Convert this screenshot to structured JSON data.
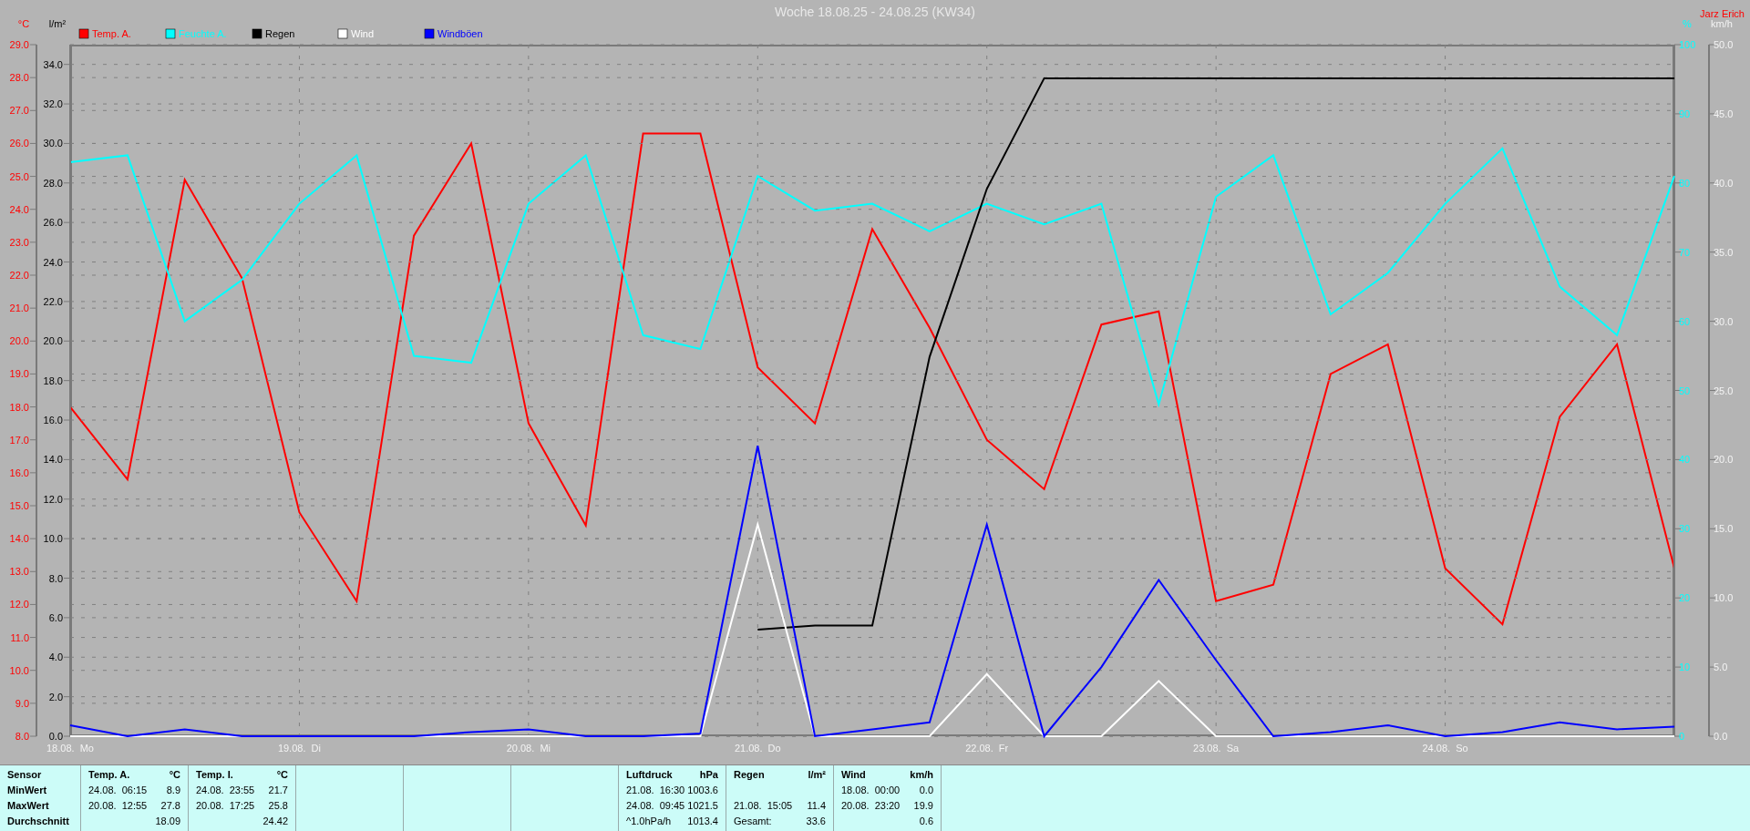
{
  "title": "Woche 18.08.25 - 24.08.25 (KW34)",
  "author": "Jarz Erich",
  "panels": [
    {
      "chart_data": {
        "type": "line",
        "ylabel": "°C",
        "grid": true,
        "legend": "top",
        "categories": [
          "18.08.  Mo",
          null,
          null,
          null,
          "19.08.  Di",
          null,
          null,
          null,
          "20.08.  Mi",
          null,
          null,
          null,
          "21.08.  Do",
          null,
          null,
          null,
          "22.08.  Fr",
          null,
          null,
          null,
          "23.08.  Sa",
          null,
          null,
          null,
          "24.08.  So",
          null,
          null,
          null,
          null
        ],
        "ylim": [
          8,
          29
        ],
        "yticks": [
          {
            "value": 29,
            "label": "29.0"
          },
          {
            "value": 28,
            "label": "28.0"
          },
          {
            "value": 27,
            "label": "27.0"
          },
          {
            "value": 26,
            "label": "26.0"
          },
          {
            "value": 25,
            "label": "25.0"
          },
          {
            "value": 24,
            "label": "24.0"
          },
          {
            "value": 23,
            "label": "23.0"
          },
          {
            "value": 22,
            "label": "22.0"
          },
          {
            "value": 21,
            "label": "21.0"
          },
          {
            "value": 20,
            "label": "20.0"
          },
          {
            "value": 19,
            "label": "19.0"
          },
          {
            "value": 18,
            "label": "18.0"
          },
          {
            "value": 17,
            "label": "17.0"
          },
          {
            "value": 16,
            "label": "16.0"
          },
          {
            "value": 15,
            "label": "15.0"
          },
          {
            "value": 14,
            "label": "14.0"
          },
          {
            "value": 13,
            "label": "13.0"
          },
          {
            "value": 12,
            "label": "12.0"
          },
          {
            "value": 11,
            "label": "11.0"
          },
          {
            "value": 10,
            "label": "10.0"
          },
          {
            "value": 9,
            "label": "9.0"
          },
          {
            "value": 8,
            "label": "8.0"
          }
        ],
        "series": [
          {
            "name": "Temp. A.",
            "color": "#ff0000",
            "values": [
              18.0,
              15.8,
              24.9,
              21.9,
              14.8,
              12.1,
              23.2,
              26.0,
              17.5,
              14.4,
              26.3,
              26.3,
              19.2,
              17.5,
              23.4,
              20.4,
              17.0,
              15.5,
              20.5,
              20.9,
              12.1,
              12.6,
              19.0,
              19.9,
              13.1,
              11.4,
              17.7,
              19.9,
              13.1
            ]
          }
        ]
      }
    },
    {
      "chart_data": {
        "type": "line",
        "ylabel": "%",
        "legend": "top",
        "categories": [
          null,
          null,
          null,
          null,
          null,
          null,
          null,
          null,
          null,
          null,
          null,
          null,
          null,
          null,
          null,
          null,
          null,
          null,
          null,
          null,
          null,
          null,
          null,
          null,
          null,
          null,
          null,
          null,
          null
        ],
        "ylim": [
          0,
          100
        ],
        "yticks": [
          {
            "value": 100,
            "label": "100"
          },
          {
            "value": 90,
            "label": "90"
          },
          {
            "value": 80,
            "label": "80"
          },
          {
            "value": 70,
            "label": "70"
          },
          {
            "value": 60,
            "label": "60"
          },
          {
            "value": 50,
            "label": "50"
          },
          {
            "value": 40,
            "label": "40"
          },
          {
            "value": 30,
            "label": "30"
          },
          {
            "value": 20,
            "label": "20"
          },
          {
            "value": 10,
            "label": "10"
          },
          {
            "value": 0,
            "label": "0"
          }
        ],
        "series": [
          {
            "name": "Feuchte A.",
            "color": "#00ffff",
            "values": [
              83,
              84,
              60,
              66,
              77,
              84,
              55,
              54,
              77,
              84,
              58,
              56,
              81,
              76,
              77,
              73,
              77,
              74,
              77,
              48,
              78,
              84,
              61,
              67,
              77,
              85,
              65,
              58,
              81
            ]
          }
        ]
      }
    },
    {
      "chart_data": {
        "type": "line",
        "ylabel": "l/m²",
        "grid": true,
        "legend": "top",
        "categories": [
          null,
          null,
          null,
          null,
          null,
          null,
          null,
          null,
          null,
          null,
          null,
          null,
          null,
          null,
          null,
          null,
          null,
          null,
          null,
          null,
          null,
          null,
          null,
          null,
          null,
          null,
          null,
          null,
          null
        ],
        "ylim": [
          0,
          35
        ],
        "yticks": [
          {
            "value": 34,
            "label": "34.0"
          },
          {
            "value": 32,
            "label": "32.0"
          },
          {
            "value": 30,
            "label": "30.0"
          },
          {
            "value": 28,
            "label": "28.0"
          },
          {
            "value": 26,
            "label": "26.0"
          },
          {
            "value": 24,
            "label": "24.0"
          },
          {
            "value": 22,
            "label": "22.0"
          },
          {
            "value": 20,
            "label": "20.0"
          },
          {
            "value": 18,
            "label": "18.0"
          },
          {
            "value": 16,
            "label": "16.0"
          },
          {
            "value": 14,
            "label": "14.0"
          },
          {
            "value": 12,
            "label": "12.0"
          },
          {
            "value": 10,
            "label": "10.0"
          },
          {
            "value": 8,
            "label": "8.0"
          },
          {
            "value": 6,
            "label": "6.0"
          },
          {
            "value": 4,
            "label": "4.0"
          },
          {
            "value": 2,
            "label": "2.0"
          },
          {
            "value": 0,
            "label": "0.0"
          }
        ],
        "series": [
          {
            "name": "Regen",
            "color": "#000000",
            "values": [
              null,
              null,
              null,
              null,
              null,
              null,
              null,
              null,
              null,
              null,
              null,
              null,
              5.4,
              5.6,
              5.6,
              19.2,
              27.7,
              33.3,
              33.3,
              33.3,
              33.3,
              33.3,
              33.3,
              33.3,
              33.3,
              33.3,
              33.3,
              33.3,
              33.3
            ]
          }
        ]
      }
    },
    {
      "chart_data": {
        "type": "line",
        "ylabel": "km/h",
        "legend": "top",
        "categories": [
          null,
          null,
          null,
          null,
          null,
          null,
          null,
          null,
          null,
          null,
          null,
          null,
          null,
          null,
          null,
          null,
          null,
          null,
          null,
          null,
          null,
          null,
          null,
          null,
          null,
          null,
          null,
          null,
          null
        ],
        "ylim": [
          0,
          50
        ],
        "yticks": [
          {
            "value": 50,
            "label": "50.0"
          },
          {
            "value": 45,
            "label": "45.0"
          },
          {
            "value": 40,
            "label": "40.0"
          },
          {
            "value": 35,
            "label": "35.0"
          },
          {
            "value": 30,
            "label": "30.0"
          },
          {
            "value": 25,
            "label": "25.0"
          },
          {
            "value": 20,
            "label": "20.0"
          },
          {
            "value": 15,
            "label": "15.0"
          },
          {
            "value": 10,
            "label": "10.0"
          },
          {
            "value": 5,
            "label": "5.0"
          },
          {
            "value": 0,
            "label": "0.0"
          }
        ],
        "series": [
          {
            "name": "Wind",
            "color": "#ffffff",
            "values": [
              0,
              0,
              0,
              0,
              0,
              0,
              0,
              0,
              0,
              0,
              0,
              0,
              15.3,
              0,
              0,
              0,
              4.5,
              0,
              0,
              4,
              0,
              0,
              0,
              0,
              0,
              0,
              0,
              0,
              0
            ]
          },
          {
            "name": "Windböen",
            "color": "#0000ff",
            "values": [
              0.8,
              0,
              0.5,
              0,
              0,
              0,
              0,
              0.3,
              0.5,
              0,
              0,
              0.2,
              21,
              0,
              0.5,
              1,
              15.3,
              0,
              5,
              11.3,
              5.5,
              0,
              0.3,
              0.8,
              0,
              0.3,
              1,
              0.5,
              0.7
            ]
          }
        ]
      }
    }
  ],
  "stats_table": {
    "row_labels": [
      "Sensor",
      "MinWert",
      "MaxWert",
      "Durchschnitt"
    ],
    "columns": [
      {
        "kind": "data",
        "header": "Temp. A.",
        "unit": "°C",
        "rows": [
          {
            "label": "24.08.  06:15",
            "value": "8.9"
          },
          {
            "label": "20.08.  12:55",
            "value": "27.8"
          },
          {
            "value": "18.09"
          }
        ]
      },
      {
        "kind": "data",
        "header": "Temp. I.",
        "unit": "°C",
        "rows": [
          {
            "label": "24.08.  23:55",
            "value": "21.7"
          },
          {
            "label": "20.08.  17:25",
            "value": "25.8"
          },
          {
            "value": "24.42"
          }
        ]
      },
      {
        "kind": "empty"
      },
      {
        "kind": "empty"
      },
      {
        "kind": "empty"
      },
      {
        "kind": "data",
        "header": "Luftdruck",
        "unit": "hPa",
        "rows": [
          {
            "label": "21.08.  16:30",
            "value": "1003.6"
          },
          {
            "label": "24.08.  09:45",
            "value": "1021.5"
          },
          {
            "label": "^1.0hPa/h",
            "value": "1013.4"
          }
        ]
      },
      {
        "kind": "data",
        "header": "Regen",
        "unit": "l/m²",
        "rows": [
          {},
          {
            "label": "21.08.  15:05",
            "value": "11.4"
          },
          {
            "label": "Gesamt:",
            "value": "33.6"
          }
        ]
      },
      {
        "kind": "data",
        "header": "Wind",
        "unit": "km/h",
        "rows": [
          {
            "label": "18.08.  00:00",
            "value": "0.0"
          },
          {
            "label": "20.08.  23:20",
            "value": "19.9"
          },
          {
            "value": "0.6"
          }
        ]
      }
    ]
  }
}
